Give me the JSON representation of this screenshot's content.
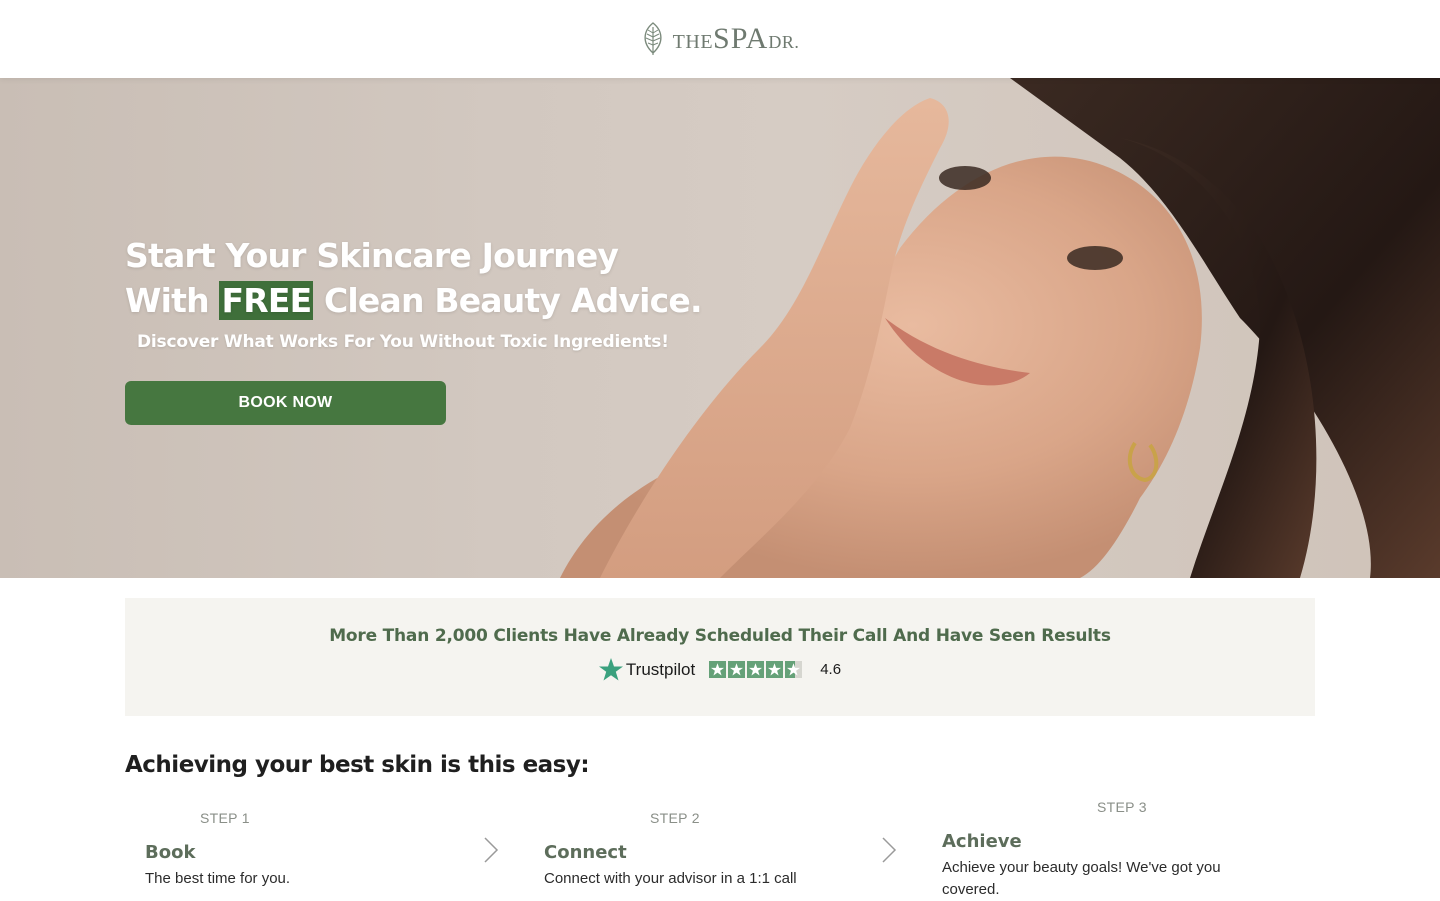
{
  "header": {
    "logo": {
      "the": "THE",
      "spa": "SPA",
      "dr": "DR",
      "mark": "."
    }
  },
  "hero": {
    "title_line1": "Start Your Skincare Journey",
    "title_line2_pre": "With ",
    "title_highlight": "FREE",
    "title_line2_post": " Clean Beauty Advice.",
    "subtitle": "Discover What Works For You Without Toxic Ingredients!",
    "cta_label": "BOOK NOW"
  },
  "social_proof": {
    "text": "More Than 2,000 Clients Have Already Scheduled Their Call And Have Seen Results",
    "brand": "Trustpilot",
    "stars": 4.6,
    "rating": "4.6"
  },
  "steps": {
    "heading": "Achieving your best skin is this easy:",
    "items": [
      {
        "label": "STEP 1",
        "title": "Book",
        "desc": "The best time for you."
      },
      {
        "label": "STEP 2",
        "title": "Connect",
        "desc": "Connect with your advisor in a 1:1 call"
      },
      {
        "label": "STEP 3",
        "title": "Achieve",
        "desc": "Achieve your beauty goals! We've got you covered."
      }
    ]
  },
  "colors": {
    "brand_green": "#467740",
    "highlight_green": "#3f6f3a",
    "proof_text": "#4f6b4d",
    "trustpilot_green": "#65a178",
    "panel_bg": "#f5f4f0"
  },
  "icons": [
    "leaf-logo-icon",
    "trustpilot-star-icon",
    "chevron-right-icon"
  ]
}
